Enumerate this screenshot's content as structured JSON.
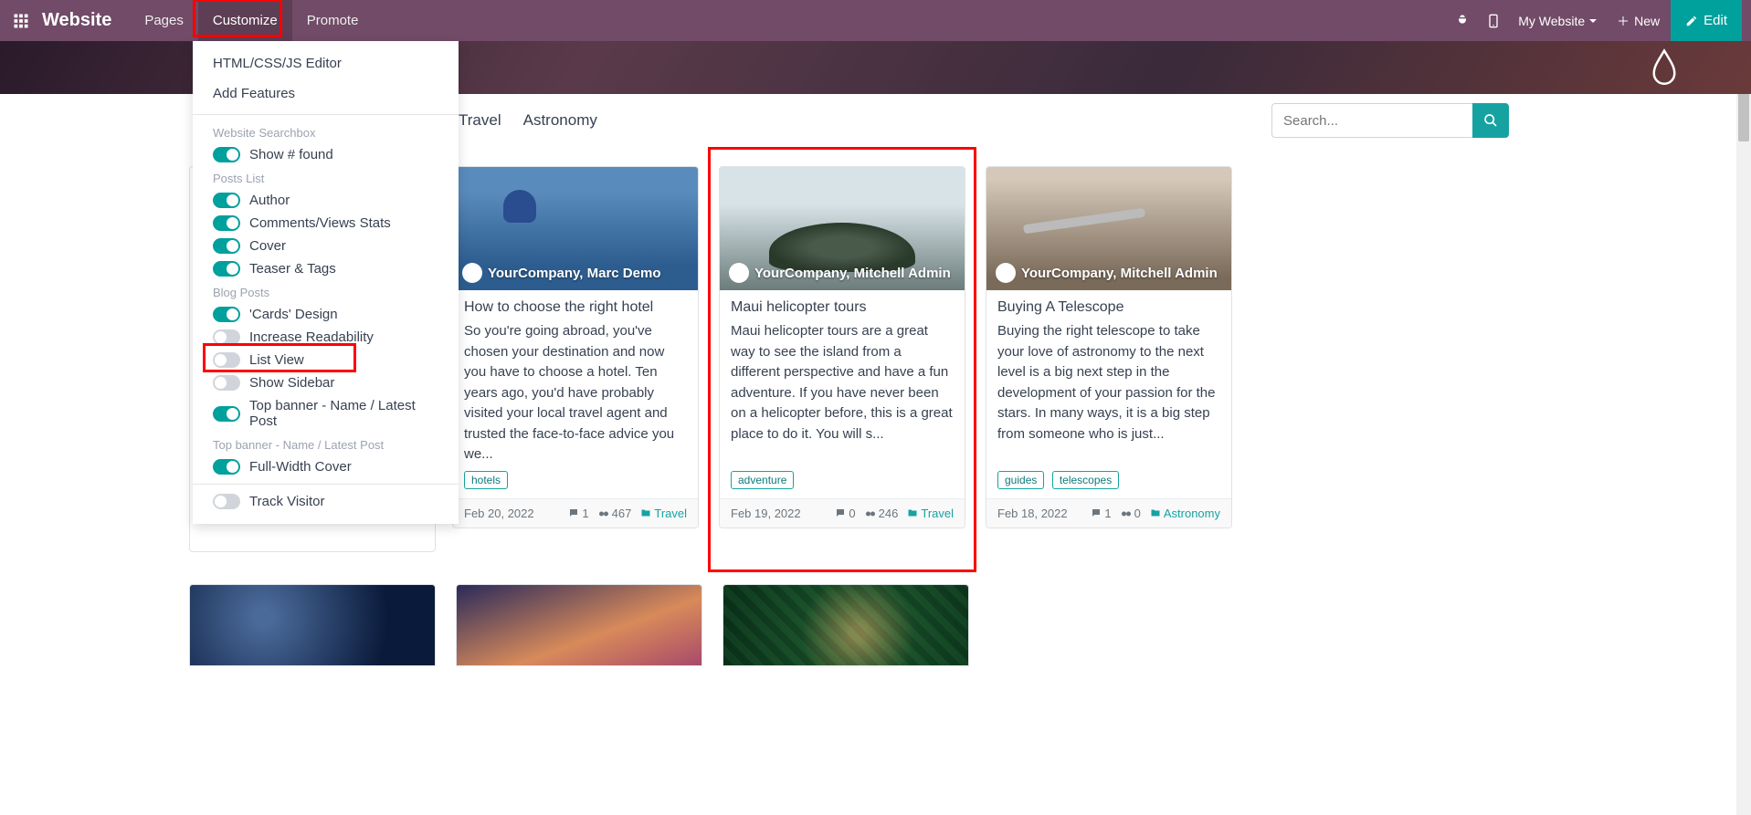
{
  "topnav": {
    "brand": "Website",
    "items": [
      "Pages",
      "Customize",
      "Promote"
    ],
    "mywebsite": "My Website",
    "new": "New",
    "edit": "Edit"
  },
  "customize_menu": {
    "actions": [
      "HTML/CSS/JS Editor",
      "Add Features"
    ],
    "sections": [
      {
        "header": "Website Searchbox",
        "toggles": [
          {
            "label": "Show # found",
            "on": true
          }
        ]
      },
      {
        "header": "Posts List",
        "toggles": [
          {
            "label": "Author",
            "on": true
          },
          {
            "label": "Comments/Views Stats",
            "on": true
          },
          {
            "label": "Cover",
            "on": true
          },
          {
            "label": "Teaser & Tags",
            "on": true
          }
        ]
      },
      {
        "header": "Blog Posts",
        "toggles": [
          {
            "label": "'Cards' Design",
            "on": true
          },
          {
            "label": "Increase Readability",
            "on": false
          },
          {
            "label": "List View",
            "on": false
          },
          {
            "label": "Show Sidebar",
            "on": false
          },
          {
            "label": "Top banner - Name / Latest Post",
            "on": true
          }
        ]
      },
      {
        "header": "Top banner - Name / Latest Post",
        "toggles": [
          {
            "label": "Full-Width Cover",
            "on": true
          }
        ]
      }
    ],
    "track_visitor": "Track Visitor"
  },
  "filters": {
    "tabs": [
      "Travel",
      "Astronomy"
    ],
    "search_placeholder": "Search..."
  },
  "cards": [
    {
      "author": "YourCompany, Marc Demo",
      "title": "How to choose the right hotel",
      "text": "So you're going abroad, you've chosen your destination and now you have to choose a hotel. Ten years ago, you'd have probably visited your local travel agent and trusted the face-to-face advice you we...",
      "tags": [
        "hotels"
      ],
      "date": "Feb 20, 2022",
      "comments": "1",
      "views": "467",
      "category": "Travel"
    },
    {
      "author": "YourCompany, Mitchell Admin",
      "title": "Maui helicopter tours",
      "text": "Maui helicopter tours are a great way to see the island from a different perspective and have a fun adventure. If you have never been on a helicopter before, this is a great place to do it. You will s...",
      "tags": [
        "adventure"
      ],
      "date": "Feb 19, 2022",
      "comments": "0",
      "views": "246",
      "category": "Travel"
    },
    {
      "author": "YourCompany, Mitchell Admin",
      "title": "Buying A Telescope",
      "text": "Buying the right telescope to take your love of astronomy to the next level is a big next step in the development of your passion for the stars. In many ways, it is a big step from someone who is just...",
      "tags": [
        "guides",
        "telescopes"
      ],
      "date": "Feb 18, 2022",
      "comments": "1",
      "views": "0",
      "category": "Astronomy"
    }
  ]
}
